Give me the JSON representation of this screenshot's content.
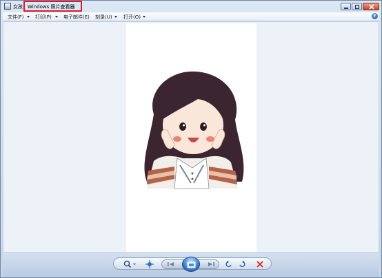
{
  "window": {
    "file_name": "女孩",
    "app_name": "Windows 照片查看器"
  },
  "menu": {
    "items": [
      {
        "label": "文件(F)"
      },
      {
        "label": "打印(P)"
      },
      {
        "label": "电子邮件(E)"
      },
      {
        "label": "刻录(U)"
      },
      {
        "label": "打开(O)"
      }
    ],
    "help_icon": "?"
  },
  "colors": {
    "highlight": "#e0182b",
    "delete": "#d82020",
    "viewer_bg": "#edf2f9"
  },
  "image": {
    "subject": "girl-illustration"
  }
}
